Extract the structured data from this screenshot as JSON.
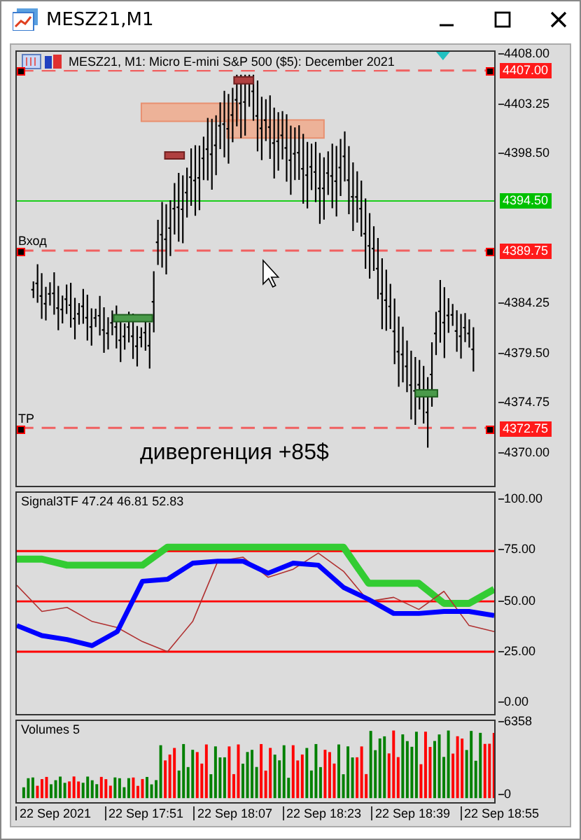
{
  "window": {
    "title": "MESZ21,M1"
  },
  "chart": {
    "header": "MESZ21, M1:  Micro E-mini S&P 500 ($5): December 2021",
    "price_ticks": [
      "4408.00",
      "4403.25",
      "4398.50",
      "4384.25",
      "4379.50",
      "4374.75",
      "4370.00"
    ],
    "levels": [
      {
        "kind": "dashed",
        "tag": "4407.00"
      },
      {
        "kind": "solid",
        "tag": "4394.50"
      },
      {
        "kind": "dashed",
        "label": "Вход",
        "tag": "4389.75"
      },
      {
        "kind": "dashed",
        "label": "TP",
        "tag": "4372.75"
      }
    ],
    "annotation": "дивергенция +85$"
  },
  "indicator": {
    "chart_data": {
      "type": "line",
      "title": "Signal3TF 47.24 46.81 52.83",
      "ylim": [
        -6,
        104
      ],
      "grid": true,
      "yticks": [
        {
          "value": 100,
          "label": "100.00"
        },
        {
          "value": 75,
          "label": "75.00"
        },
        {
          "value": 50,
          "label": "50.00"
        },
        {
          "value": 25,
          "label": "25.00"
        },
        {
          "value": 0,
          "label": "0.00"
        }
      ],
      "series": [
        {
          "color": "#33cc33",
          "values": [
            71,
            71,
            68,
            68,
            68,
            68,
            77,
            77,
            77,
            77,
            77,
            77,
            77,
            77,
            59,
            59,
            59,
            49,
            49,
            56
          ]
        },
        {
          "color": "#b03030",
          "values": [
            58,
            45,
            47,
            40,
            37,
            30,
            25,
            40,
            70,
            72,
            62,
            66,
            74,
            65,
            50,
            52,
            46,
            55,
            38,
            35
          ]
        },
        {
          "color": "#0000ff",
          "values": [
            38,
            33,
            31,
            28,
            35,
            60,
            61,
            69,
            70,
            70,
            64,
            69,
            68,
            57,
            51,
            44,
            44,
            45,
            45,
            43
          ]
        }
      ]
    }
  },
  "volumes": {
    "header": "Volumes 5",
    "ticks": [
      "6358",
      "0"
    ]
  },
  "time_axis": [
    "22 Sep 2021",
    "22 Sep 17:51",
    "22 Sep 18:07",
    "22 Sep 18:23",
    "22 Sep 18:39",
    "22 Sep 18:55"
  ]
}
